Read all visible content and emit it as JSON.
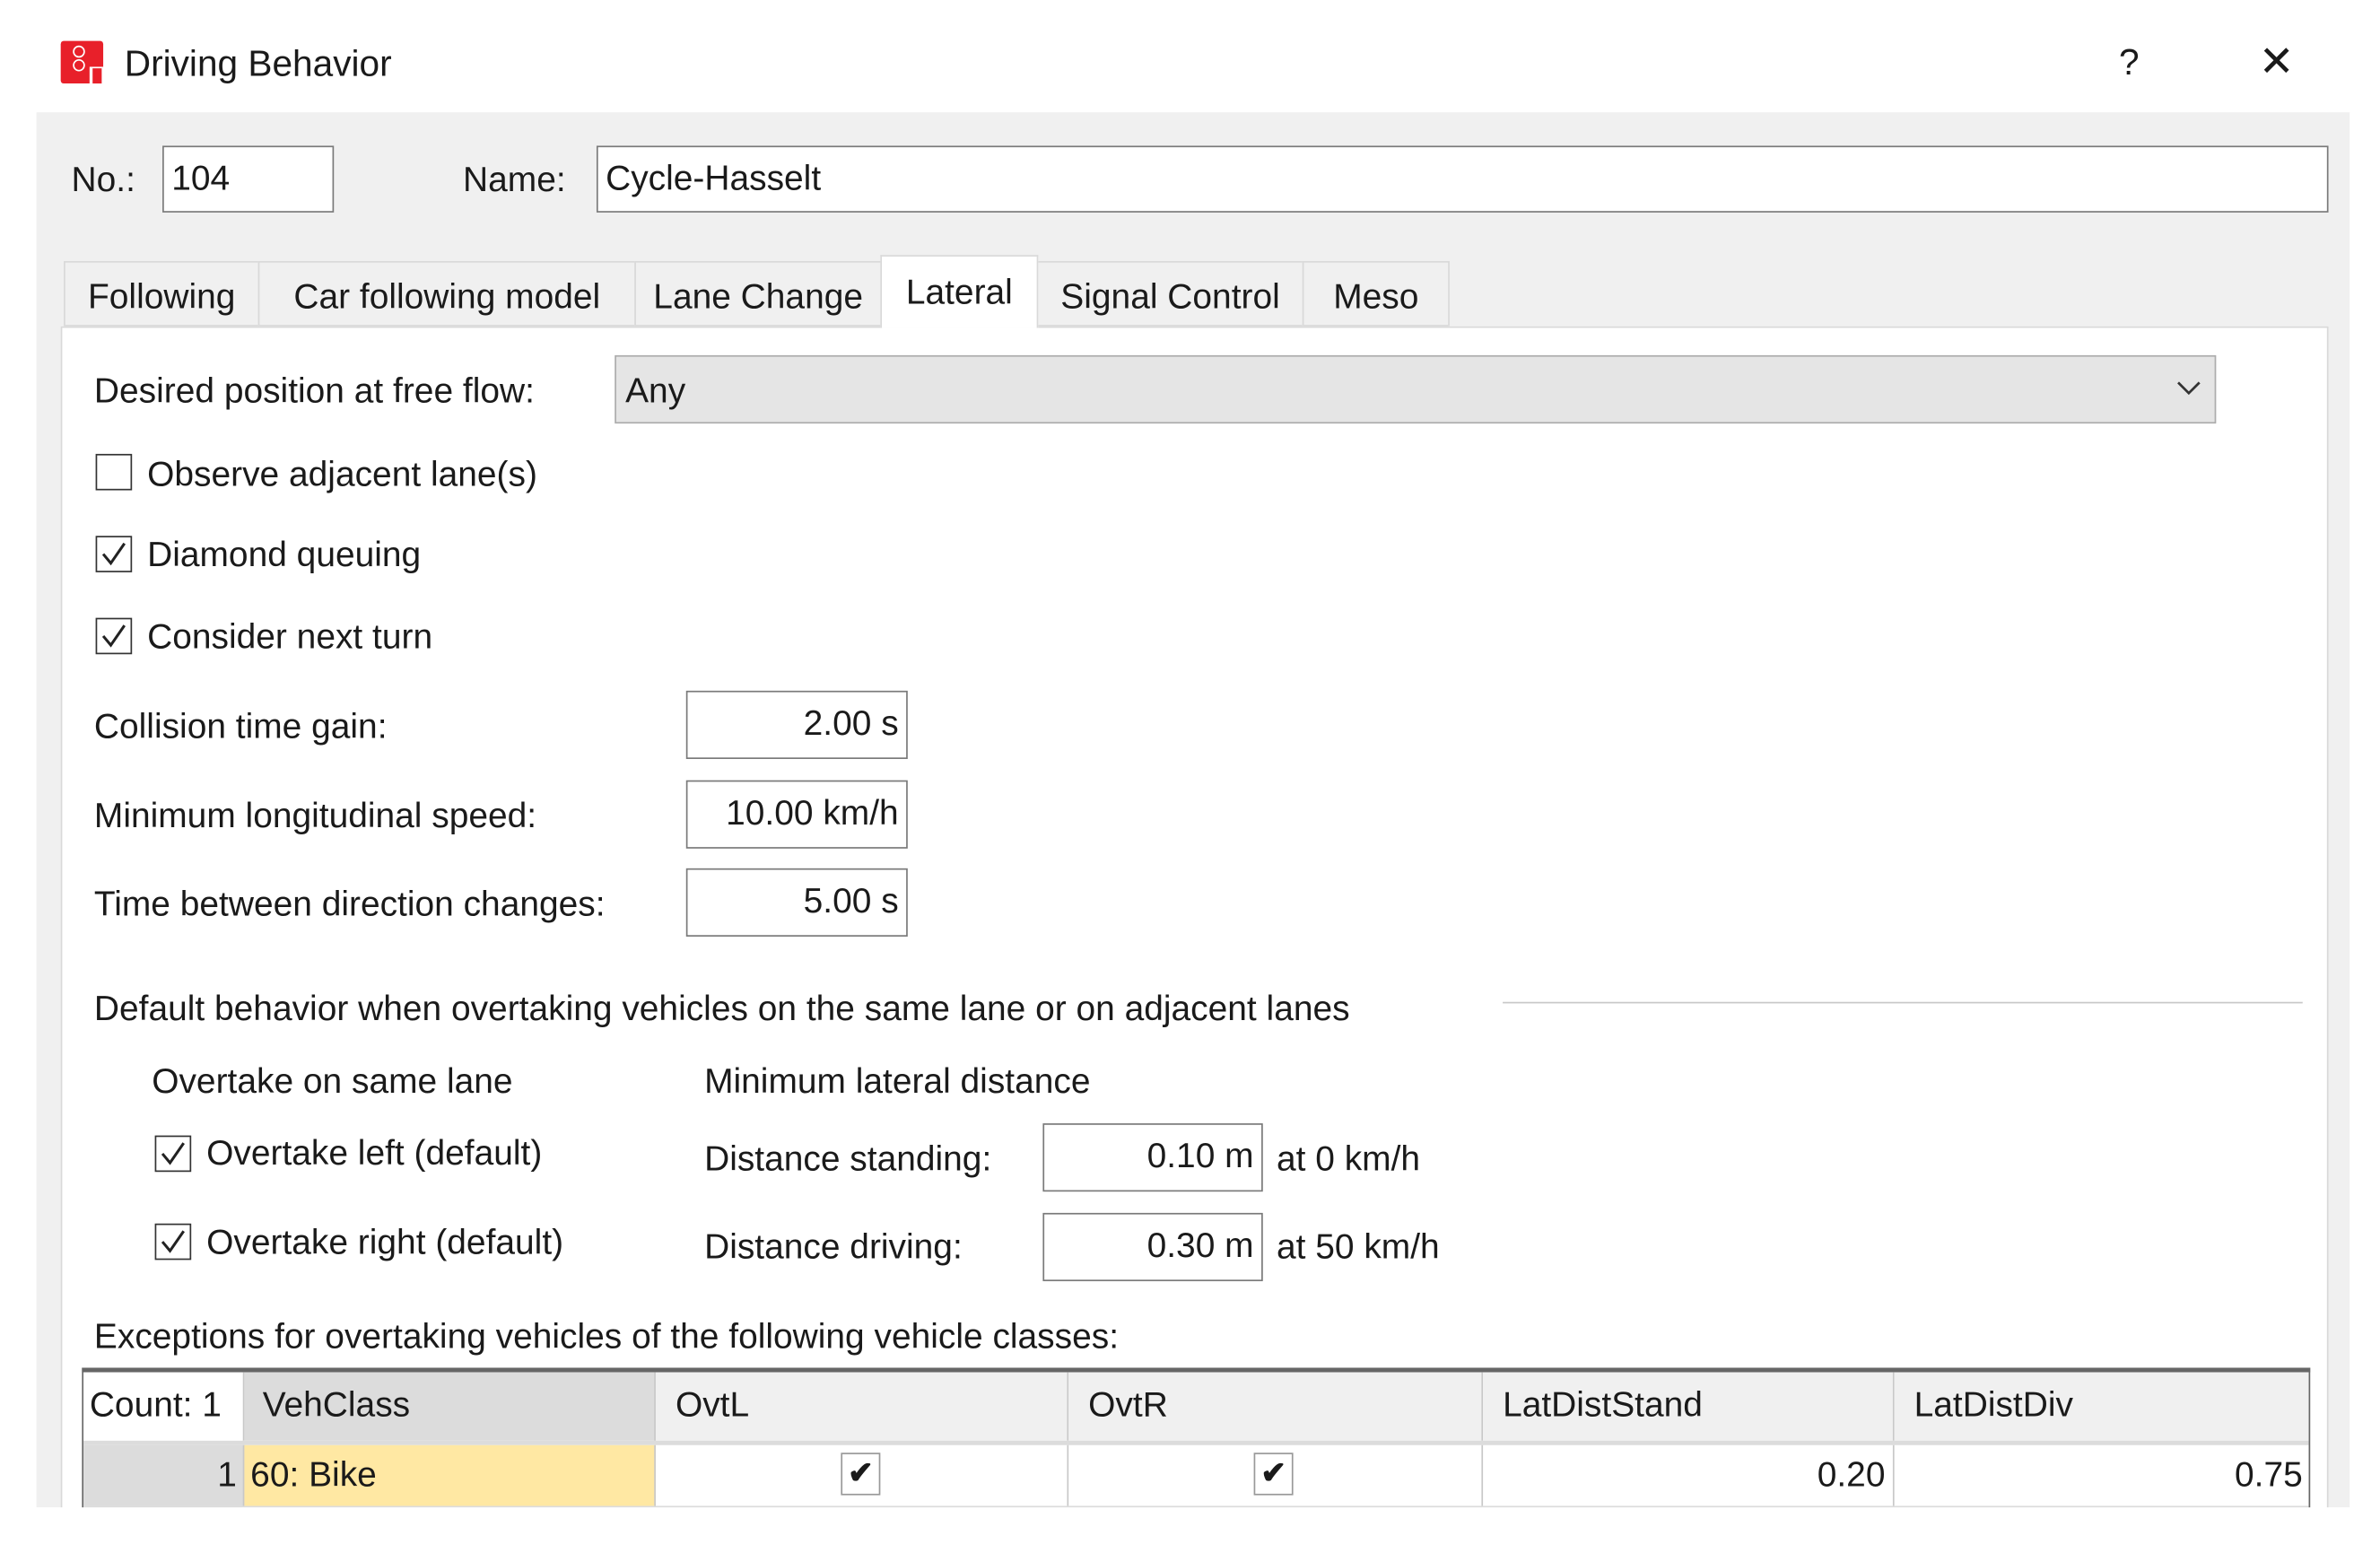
{
  "window": {
    "title": "Driving Behavior",
    "help_label": "?",
    "close_label": "✕"
  },
  "header": {
    "no_label": "No.:",
    "no_value": "104",
    "name_label": "Name:",
    "name_value": "Cycle-Hasselt"
  },
  "tabs": [
    {
      "label": "Following"
    },
    {
      "label": "Car following model"
    },
    {
      "label": "Lane Change"
    },
    {
      "label": "Lateral",
      "selected": true
    },
    {
      "label": "Signal Control"
    },
    {
      "label": "Meso"
    }
  ],
  "lateral": {
    "desired_position_label": "Desired position at free flow:",
    "desired_position_value": "Any",
    "observe_adjacent": {
      "label": "Observe adjacent lane(s)",
      "checked": false
    },
    "diamond_queuing": {
      "label": "Diamond queuing",
      "checked": true
    },
    "consider_next_turn": {
      "label": "Consider next turn",
      "checked": true
    },
    "collision_time_gain_label": "Collision time gain:",
    "collision_time_gain_value": "2.00 s",
    "min_long_speed_label": "Minimum longitudinal speed:",
    "min_long_speed_value": "10.00 km/h",
    "time_dir_changes_label": "Time between direction changes:",
    "time_dir_changes_value": "5.00 s",
    "group_title": "Default behavior when overtaking vehicles on the same lane or on adjacent lanes",
    "overtake_same_lane_label": "Overtake on same lane",
    "overtake_left": {
      "label": "Overtake left (default)",
      "checked": true
    },
    "overtake_right": {
      "label": "Overtake right (default)",
      "checked": true
    },
    "min_lat_dist_label": "Minimum lateral distance",
    "dist_standing_label": "Distance standing:",
    "dist_standing_value": "0.10 m",
    "dist_standing_suffix": "at 0 km/h",
    "dist_driving_label": "Distance driving:",
    "dist_driving_value": "0.30 m",
    "dist_driving_suffix": "at 50 km/h",
    "exceptions_label": "Exceptions for overtaking vehicles of the following vehicle classes:"
  },
  "table": {
    "count_label": "Count: 1",
    "columns": [
      "VehClass",
      "OvtL",
      "OvtR",
      "LatDistStand",
      "LatDistDiv"
    ],
    "rows": [
      {
        "index": "1",
        "vehclass": "60: Bike",
        "ovtl": "✔",
        "ovtr": "✔",
        "latdiststand": "0.20",
        "latdistdriv": "0.75"
      }
    ]
  }
}
